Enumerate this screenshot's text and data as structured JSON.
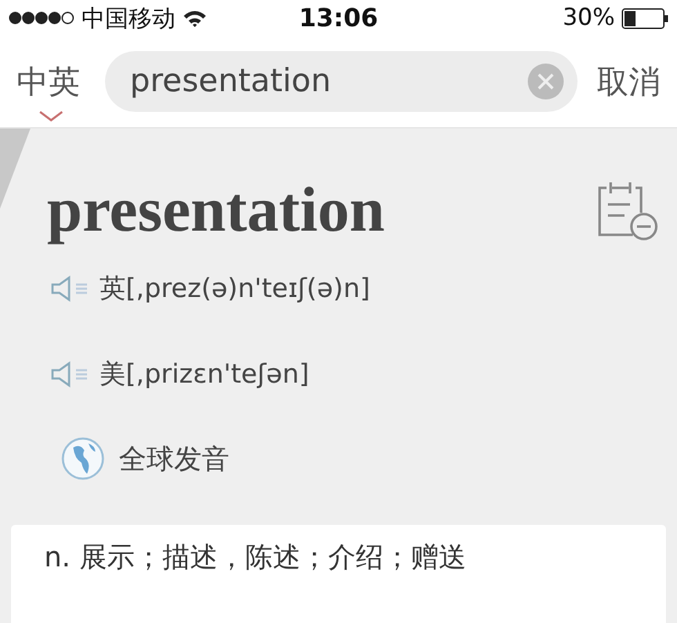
{
  "status_bar": {
    "carrier": "中国移动",
    "time": "13:06",
    "battery": "30%"
  },
  "search_bar": {
    "language": "中英",
    "value": "presentation",
    "cancel": "取消"
  },
  "entry": {
    "word": "presentation",
    "pronunciations": [
      {
        "label": "英[,prez(ə)n'teɪʃ(ə)n]"
      },
      {
        "label": "美[,prizɛn'teʃən]"
      }
    ],
    "global_pronunciation": "全球发音",
    "definitions": [
      "n. 展示；描述，陈述；介绍；赠送"
    ]
  }
}
